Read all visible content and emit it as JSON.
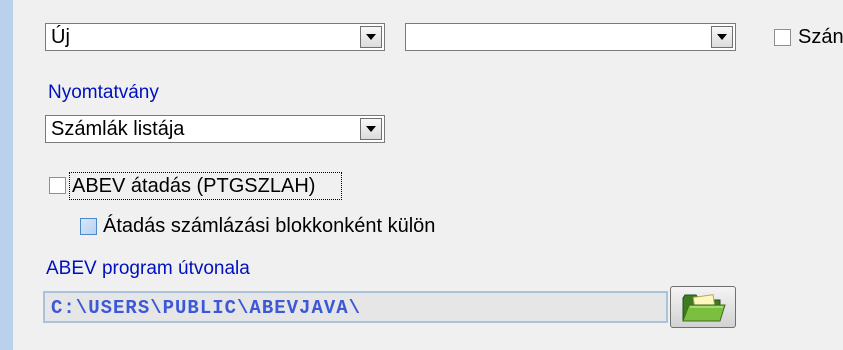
{
  "top_combo_1": {
    "value": "Új"
  },
  "top_combo_2": {
    "value": ""
  },
  "top_checkbox": {
    "label": "Szán"
  },
  "form_section": {
    "label": "Nyomtatvány",
    "combo_value": "Számlák listája"
  },
  "abev_transfer": {
    "label": "ABEV átadás (PTGSZLAH)",
    "checked": false
  },
  "per_block_transfer": {
    "label": "Átadás számlázási blokkonként külön",
    "checked": false
  },
  "abev_path": {
    "label": "ABEV program útvonala",
    "value": "C:\\USERS\\PUBLIC\\ABEVJAVA\\"
  },
  "icons": {
    "dropdown": "chevron-down-icon",
    "browse": "folder-open-icon"
  },
  "colors": {
    "accent_label": "#0010c0",
    "path_text": "#3a58d8",
    "left_strip": "#b9d1ea",
    "folder_green": "#4f8a2c"
  }
}
